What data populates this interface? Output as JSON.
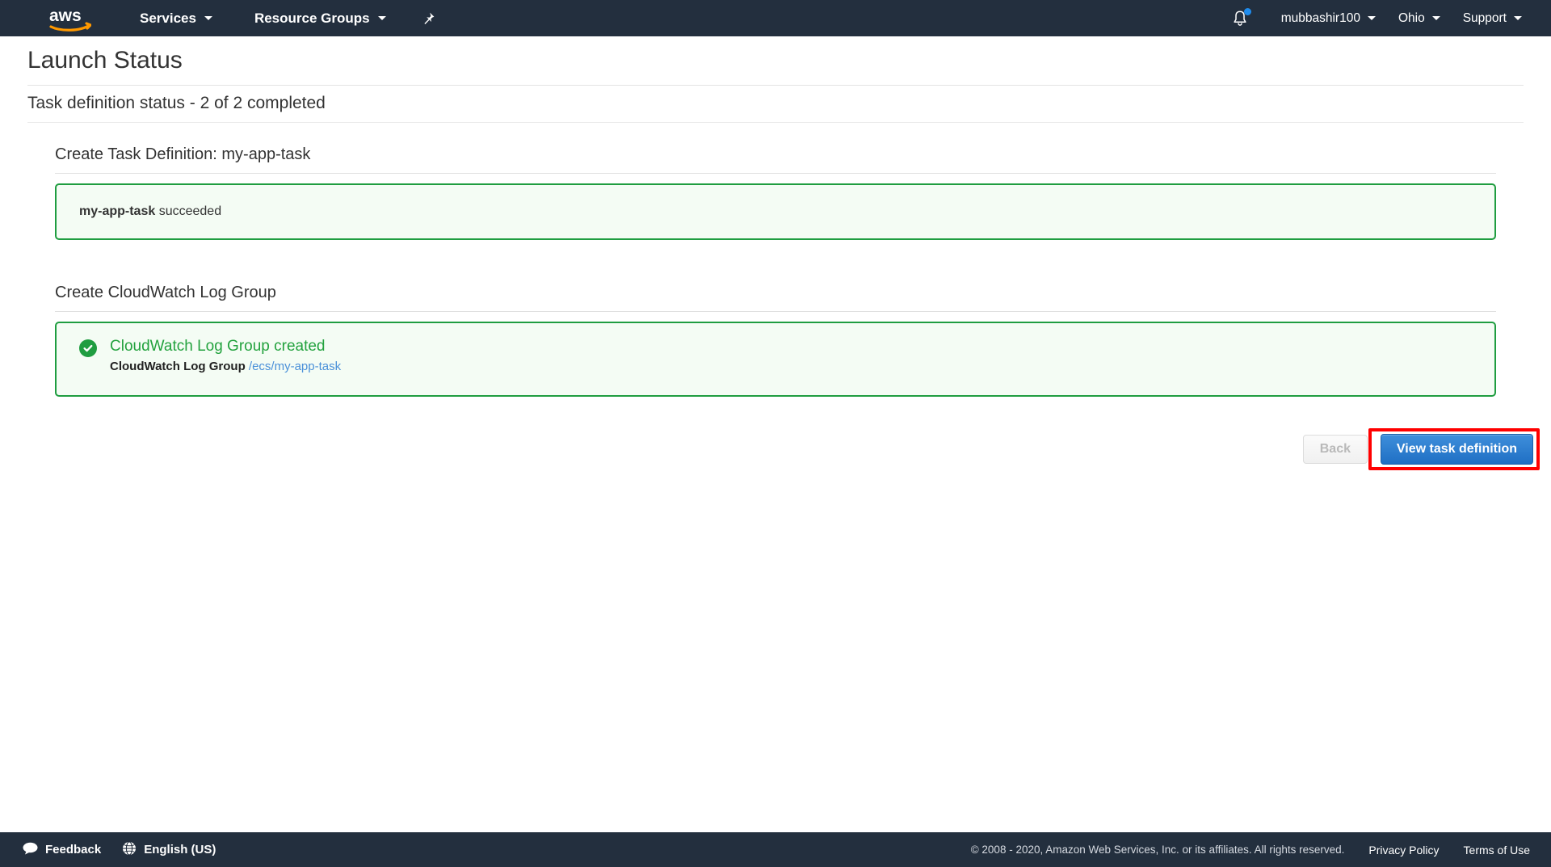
{
  "navbar": {
    "logo_alt": "aws",
    "services_label": "Services",
    "resource_groups_label": "Resource Groups",
    "pin_icon": "pushpin-icon",
    "bell_icon": "notifications-bell-icon",
    "account_label": "mubbashir100",
    "region_label": "Ohio",
    "support_label": "Support",
    "accent_notification_color": "#1f8ced",
    "background_color": "#232f3e"
  },
  "page": {
    "title": "Launch Status",
    "subtitle": "Task definition status - 2 of 2 completed"
  },
  "sections": [
    {
      "heading": "Create Task Definition: my-app-task",
      "kind": "plain",
      "bold_text": "my-app-task",
      "rest_text": " succeeded"
    },
    {
      "heading": "Create CloudWatch Log Group",
      "kind": "detailed",
      "status_icon": "check-circle-icon",
      "status_title": "CloudWatch Log Group created",
      "detail_label": "CloudWatch Log Group",
      "detail_link": "/ecs/my-app-task",
      "success_color": "#23a23e",
      "link_color": "#4a90d9"
    }
  ],
  "actions": {
    "back_label": "Back",
    "primary_label": "View task definition",
    "primary_color": "#2f7fd0",
    "highlight_color": "#ff0000"
  },
  "footer": {
    "feedback_label": "Feedback",
    "feedback_icon": "speech-bubble-icon",
    "language_label": "English (US)",
    "language_icon": "globe-icon",
    "copyright": "© 2008 - 2020, Amazon Web Services, Inc. or its affiliates. All rights reserved.",
    "privacy_label": "Privacy Policy",
    "terms_label": "Terms of Use"
  }
}
